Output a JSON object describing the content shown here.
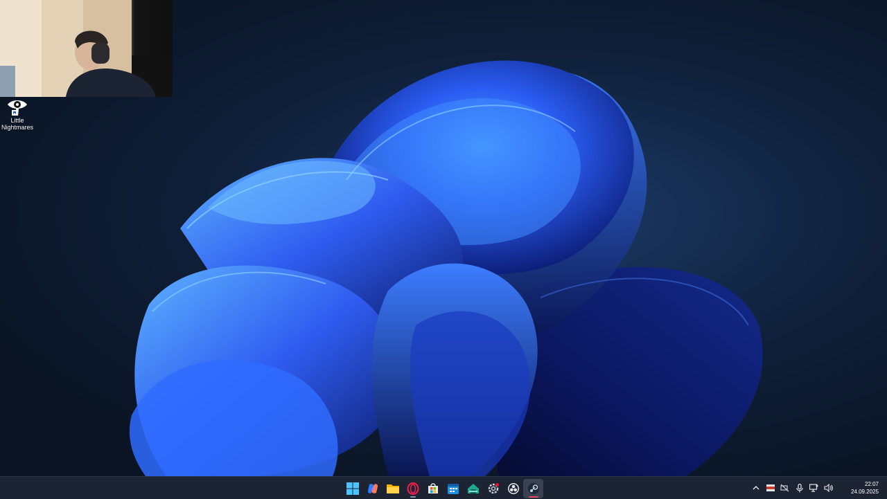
{
  "desktop": {
    "icons": [
      {
        "label": "Little Nightmares",
        "icon": "little-nightmares-eye-icon"
      }
    ]
  },
  "taskbar": {
    "apps": [
      {
        "icon": "windows-start-icon"
      },
      {
        "icon": "copilot-icon"
      },
      {
        "icon": "file-explorer-icon"
      },
      {
        "icon": "opera-gx-icon"
      },
      {
        "icon": "microsoft-store-icon"
      },
      {
        "icon": "calendar-app-icon"
      },
      {
        "icon": "game-launcher-icon"
      },
      {
        "icon": "settings-gear-icon"
      },
      {
        "icon": "obs-studio-icon"
      },
      {
        "icon": "steam-icon"
      }
    ],
    "tray": {
      "icons": [
        "chevron-up-icon",
        "language-flag-icon",
        "network-icon",
        "microphone-icon",
        "display-icon",
        "volume-icon"
      ],
      "time": "22:07",
      "date": "24.09.2025"
    }
  },
  "colors": {
    "accent": "#60cdff",
    "taskbar": "#1c2433",
    "wallpaper_blue": "#2f5cf0"
  }
}
